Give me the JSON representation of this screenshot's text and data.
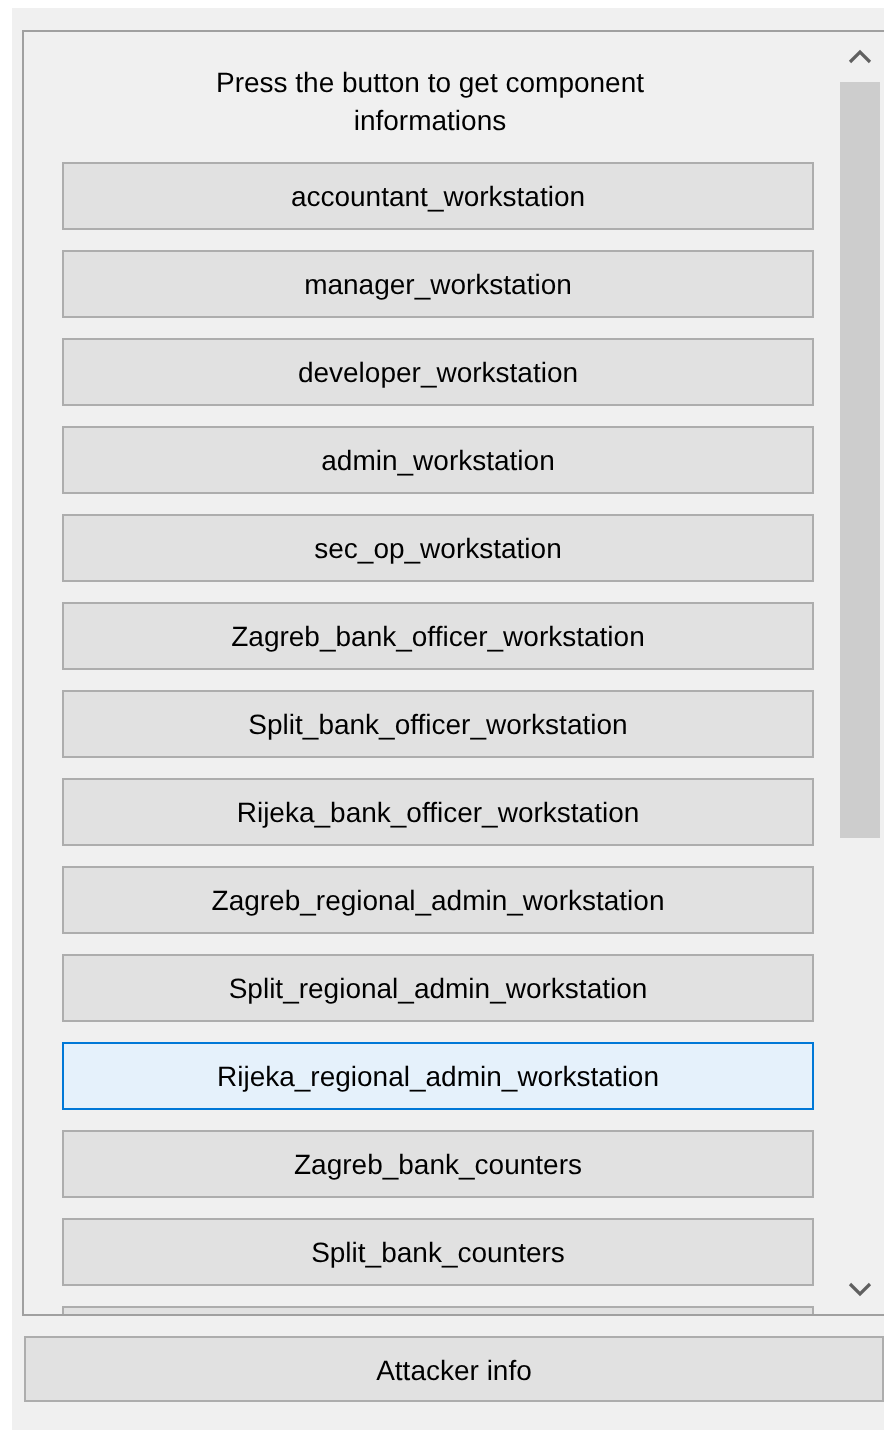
{
  "prompt": "Press the button to get component informations",
  "components": [
    {
      "label": "accountant_workstation",
      "selected": false
    },
    {
      "label": "manager_workstation",
      "selected": false
    },
    {
      "label": "developer_workstation",
      "selected": false
    },
    {
      "label": "admin_workstation",
      "selected": false
    },
    {
      "label": "sec_op_workstation",
      "selected": false
    },
    {
      "label": "Zagreb_bank_officer_workstation",
      "selected": false
    },
    {
      "label": "Split_bank_officer_workstation",
      "selected": false
    },
    {
      "label": "Rijeka_bank_officer_workstation",
      "selected": false
    },
    {
      "label": "Zagreb_regional_admin_workstation",
      "selected": false
    },
    {
      "label": "Split_regional_admin_workstation",
      "selected": false
    },
    {
      "label": "Rijeka_regional_admin_workstation",
      "selected": true
    },
    {
      "label": "Zagreb_bank_counters",
      "selected": false
    },
    {
      "label": "Split_bank_counters",
      "selected": false
    }
  ],
  "footer_button": "Attacker info"
}
